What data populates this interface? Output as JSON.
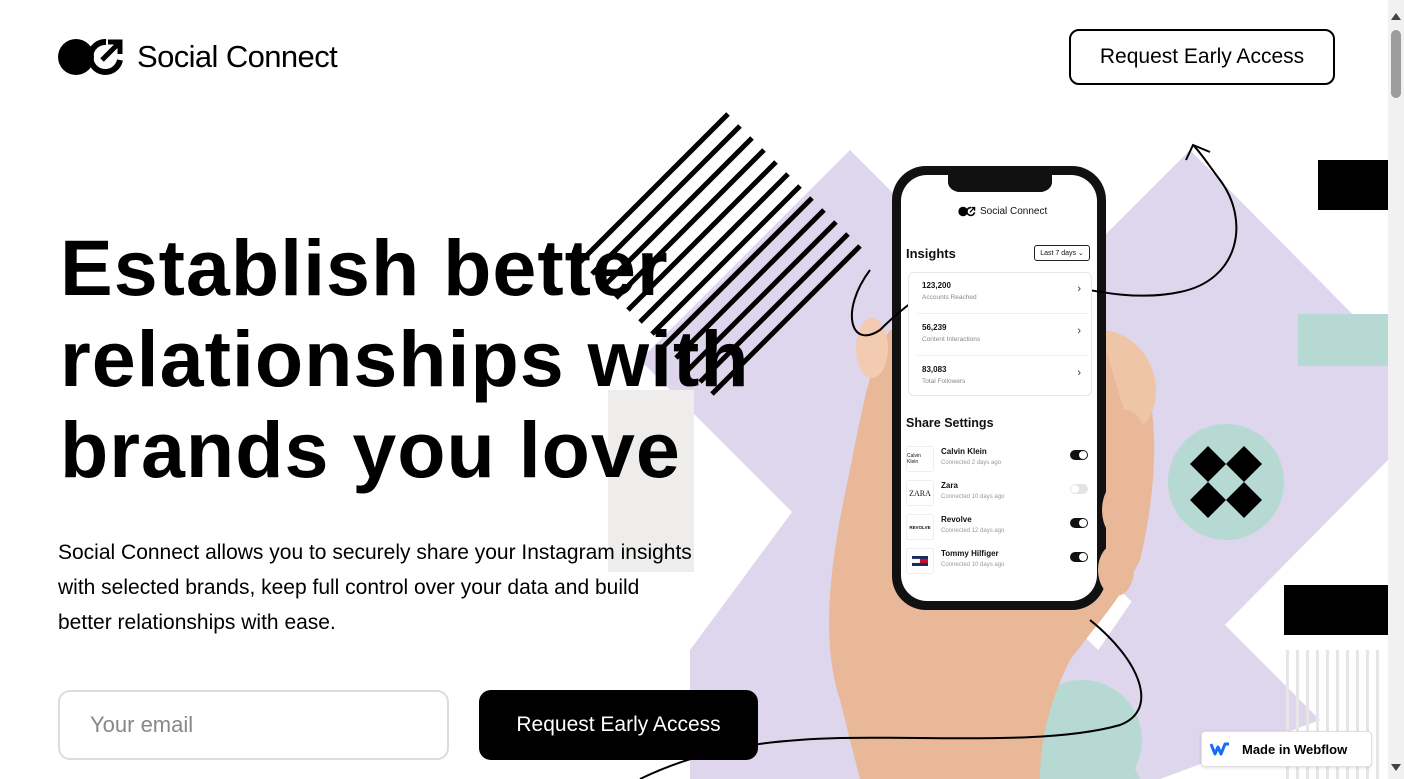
{
  "brand": {
    "name": "Social Connect"
  },
  "header": {
    "cta_label": "Request Early Access"
  },
  "hero": {
    "title_lines": [
      "Establish better",
      "relationships with",
      "brands you love"
    ],
    "description": "Social Connect allows you to securely share your Instagram insights with selected brands, keep full control over your data and build better relationships with ease."
  },
  "signup": {
    "email_placeholder": "Your email",
    "submit_label": "Request Early Access"
  },
  "phone": {
    "brand": "Social Connect",
    "insights_title": "Insights",
    "range_label": "Last 7 days ⌄",
    "stats": [
      {
        "value": "123,200",
        "label": "Accounts Reached"
      },
      {
        "value": "56,239",
        "label": "Content Interactions"
      },
      {
        "value": "83,083",
        "label": "Total Followers"
      }
    ],
    "share_title": "Share Settings",
    "brands": [
      {
        "name": "Calvin Klein",
        "sub": "Connected 2 days ago",
        "logo": "Calvin Klein",
        "enabled": true
      },
      {
        "name": "Zara",
        "sub": "Connected 10 days ago",
        "logo": "ZARA",
        "enabled": false
      },
      {
        "name": "Revolve",
        "sub": "Connected 12 days ago",
        "logo": "REVOLVE",
        "enabled": true
      },
      {
        "name": "Tommy Hilfiger",
        "sub": "Connected 10 days ago",
        "logo": "tommy-flag",
        "enabled": true
      }
    ]
  },
  "badge": {
    "label": "Made in Webflow",
    "icon": "webflow-logo-icon"
  },
  "colors": {
    "lavender": "#ddd6ec",
    "mint": "#b7d9d4",
    "black": "#000000",
    "skin": "#e8b899"
  }
}
